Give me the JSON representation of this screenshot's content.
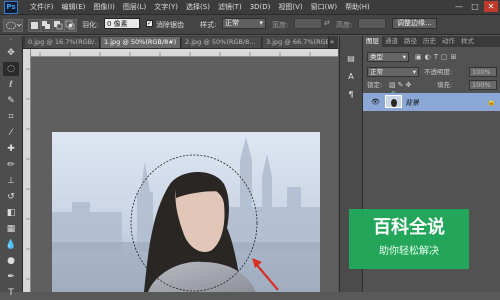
{
  "app": {
    "logo": "Ps"
  },
  "menu": [
    "文件(F)",
    "编辑(E)",
    "图像(I)",
    "图层(L)",
    "文字(Y)",
    "选择(S)",
    "滤镜(T)",
    "3D(D)",
    "视图(V)",
    "窗口(W)",
    "帮助(H)"
  ],
  "window_controls": {
    "minimize": "—",
    "maximize": "□",
    "close": "✕"
  },
  "options": {
    "feather_label": "羽化:",
    "feather_value": "0 像素",
    "antialias_label": "消除锯齿",
    "antialias_checked": true,
    "style_label": "样式:",
    "style_value": "正常",
    "width_label": "宽度:",
    "height_label": "高度:",
    "refine_button": "调整边缘..."
  },
  "tabs": [
    {
      "label": "0.jpg @ 16.7%(RGB/...",
      "active": false
    },
    {
      "label": "1.jpg @ 50%(RGB/8#)",
      "active": true
    },
    {
      "label": "2.jpg @ 50%(RGB/8...",
      "active": false
    },
    {
      "label": "3.jpg @ 66.7%(RGB/...",
      "active": false
    }
  ],
  "tab_overflow": "»",
  "panel": {
    "tabs": [
      "图层",
      "通道",
      "路径",
      "历史",
      "动作",
      "样式"
    ],
    "kind_label": "类型",
    "blend_mode": "正常",
    "opacity_label": "不透明度:",
    "opacity_value": "100%",
    "lock_label": "锁定:",
    "fill_label": "填充:",
    "fill_value": "100%",
    "layer_name": "背景"
  },
  "watermark": {
    "title": "百科全说",
    "subtitle": "助你轻松解决"
  },
  "colors": {
    "accent_selection": "#8aa7d6",
    "arrow": "#d93025",
    "watermark_bg": "#1fae5a"
  }
}
